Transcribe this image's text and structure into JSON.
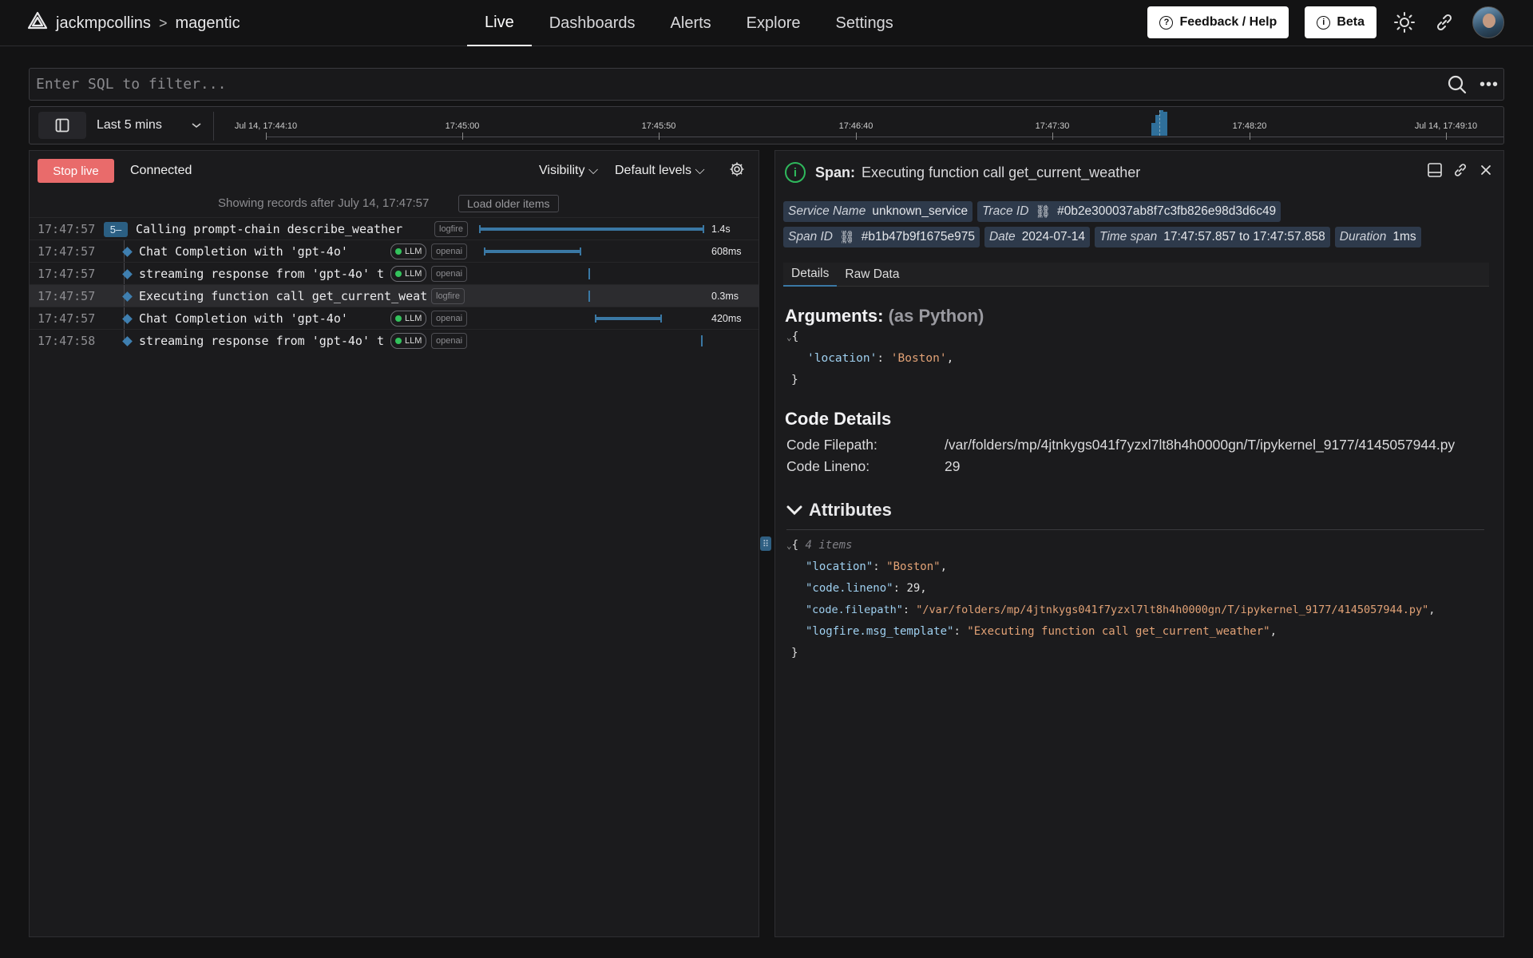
{
  "nav": {
    "org": "jackmpcollins",
    "separator": ">",
    "project": "magentic",
    "tabs": [
      "Live",
      "Dashboards",
      "Alerts",
      "Explore",
      "Settings"
    ],
    "active_tab": "Live",
    "feedback_label": "Feedback / Help",
    "beta_label": "Beta",
    "icons": [
      "logfire-logo-icon",
      "help-circle-icon",
      "info-icon",
      "theme-sun-icon",
      "link-icon",
      "avatar"
    ]
  },
  "search": {
    "placeholder": "Enter SQL to filter...",
    "value": ""
  },
  "timeline": {
    "range_label": "Last 5 mins",
    "ticks": [
      "Jul 14, 17:44:10",
      "17:45:00",
      "17:45:50",
      "17:46:40",
      "17:47:30",
      "17:48:20",
      "Jul 14, 17:49:10"
    ]
  },
  "live": {
    "stop_label": "Stop live",
    "status": "Connected",
    "visibility_label": "Visibility",
    "levels_label": "Default levels",
    "showing_text": "Showing records after July 14, 17:47:57",
    "load_older_label": "Load older items",
    "rows": [
      {
        "time": "17:47:57",
        "count": "5–",
        "name": "Calling prompt-chain describe_weather",
        "tags": [
          "logfire"
        ],
        "duration": "1.4s"
      },
      {
        "time": "17:47:57",
        "name": "Chat Completion with 'gpt-4o'",
        "tags": [
          "LLM",
          "openai"
        ],
        "duration": "608ms"
      },
      {
        "time": "17:47:57",
        "name": "streaming response from 'gpt-4o' t",
        "tags": [
          "LLM",
          "openai"
        ],
        "duration": ""
      },
      {
        "time": "17:47:57",
        "name": "Executing function call get_current_weat",
        "tags": [
          "logfire"
        ],
        "duration": "0.3ms"
      },
      {
        "time": "17:47:57",
        "name": "Chat Completion with 'gpt-4o'",
        "tags": [
          "LLM",
          "openai"
        ],
        "duration": "420ms"
      },
      {
        "time": "17:47:58",
        "name": "streaming response from 'gpt-4o' t",
        "tags": [
          "LLM",
          "openai"
        ],
        "duration": ""
      }
    ]
  },
  "span": {
    "label": "Span:",
    "title": "Executing function call get_current_weather",
    "chips": {
      "service_key": "Service Name",
      "service_val": "unknown_service",
      "trace_key": "Trace ID",
      "trace_val": "#0b2e300037ab8f7c3fb826e98d3d6c49",
      "spanid_key": "Span ID",
      "spanid_val": "#b1b47b9f1675e975",
      "date_key": "Date",
      "date_val": "2024-07-14",
      "timespan_key": "Time span",
      "timespan_val": "17:47:57.857 to 17:47:57.858",
      "duration_key": "Duration",
      "duration_val": "1ms"
    },
    "tabs": [
      "Details",
      "Raw Data"
    ],
    "arguments_title": "Arguments:",
    "arguments_sub": "(as Python)",
    "arguments": {
      "key": "'location'",
      "value": "'Boston'"
    },
    "code_title": "Code Details",
    "code_filepath_label": "Code Filepath:",
    "code_filepath": "/var/folders/mp/4jtnkygs041f7yzxl7lt8h4h0000gn/T/ipykernel_9177/4145057944.py",
    "code_lineno_label": "Code Lineno:",
    "code_lineno": "29",
    "attributes_title": "Attributes",
    "attributes_count": "4 items",
    "attributes": [
      {
        "key": "\"location\"",
        "value": "\"Boston\""
      },
      {
        "key": "\"code.lineno\"",
        "value": "29"
      },
      {
        "key": "\"code.filepath\"",
        "value": "\"/var/folders/mp/4jtnkygs041f7yzxl7lt8h4h0000gn/T/ipykernel_9177/4145057944.py\""
      },
      {
        "key": "\"logfire.msg_template\"",
        "value": "\"Executing function call get_current_weather\""
      }
    ]
  }
}
